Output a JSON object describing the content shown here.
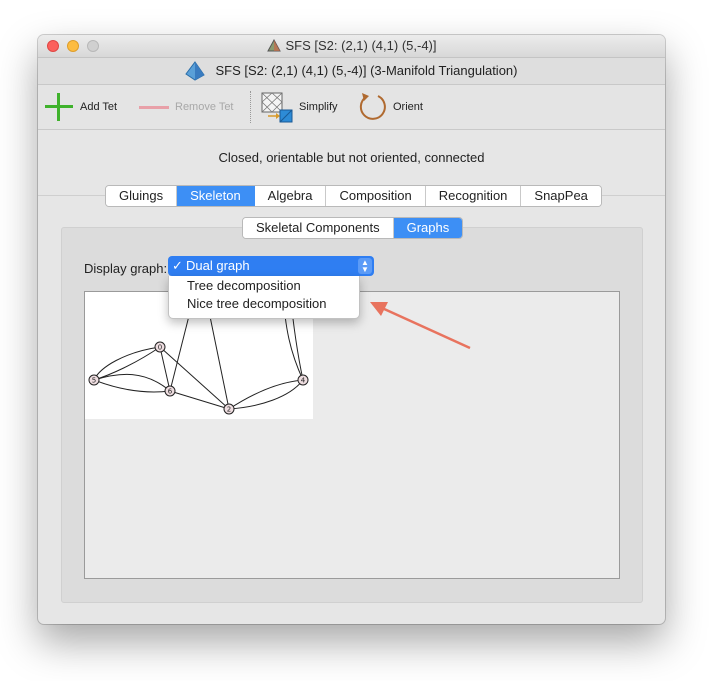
{
  "window": {
    "title": "SFS [S2: (2,1) (4,1) (5,-4)]",
    "subtitle": "SFS [S2: (2,1) (4,1) (5,-4)] (3-Manifold Triangulation)"
  },
  "toolbar": {
    "add_label": "Add Tet",
    "remove_label": "Remove Tet",
    "simplify_label": "Simplify",
    "orient_label": "Orient"
  },
  "status": "Closed, orientable but not oriented, connected",
  "tabs": [
    "Gluings",
    "Skeleton",
    "Algebra",
    "Composition",
    "Recognition",
    "SnapPea"
  ],
  "active_tab": "Skeleton",
  "subtabs": [
    "Skeletal Components",
    "Graphs"
  ],
  "active_subtab": "Graphs",
  "display": {
    "label": "Display graph:",
    "selected": "Dual graph",
    "check": "✓",
    "options": [
      "Dual graph",
      "Tree decomposition",
      "Nice tree decomposition"
    ]
  },
  "graph_nodes": [
    "0",
    "5",
    "6",
    "2",
    "4"
  ],
  "colors": {
    "accent": "#3d8ff5",
    "annotation_arrow": "#e8735e",
    "add_icon": "#3fb22c",
    "remove_icon": "#e8a0a8"
  }
}
